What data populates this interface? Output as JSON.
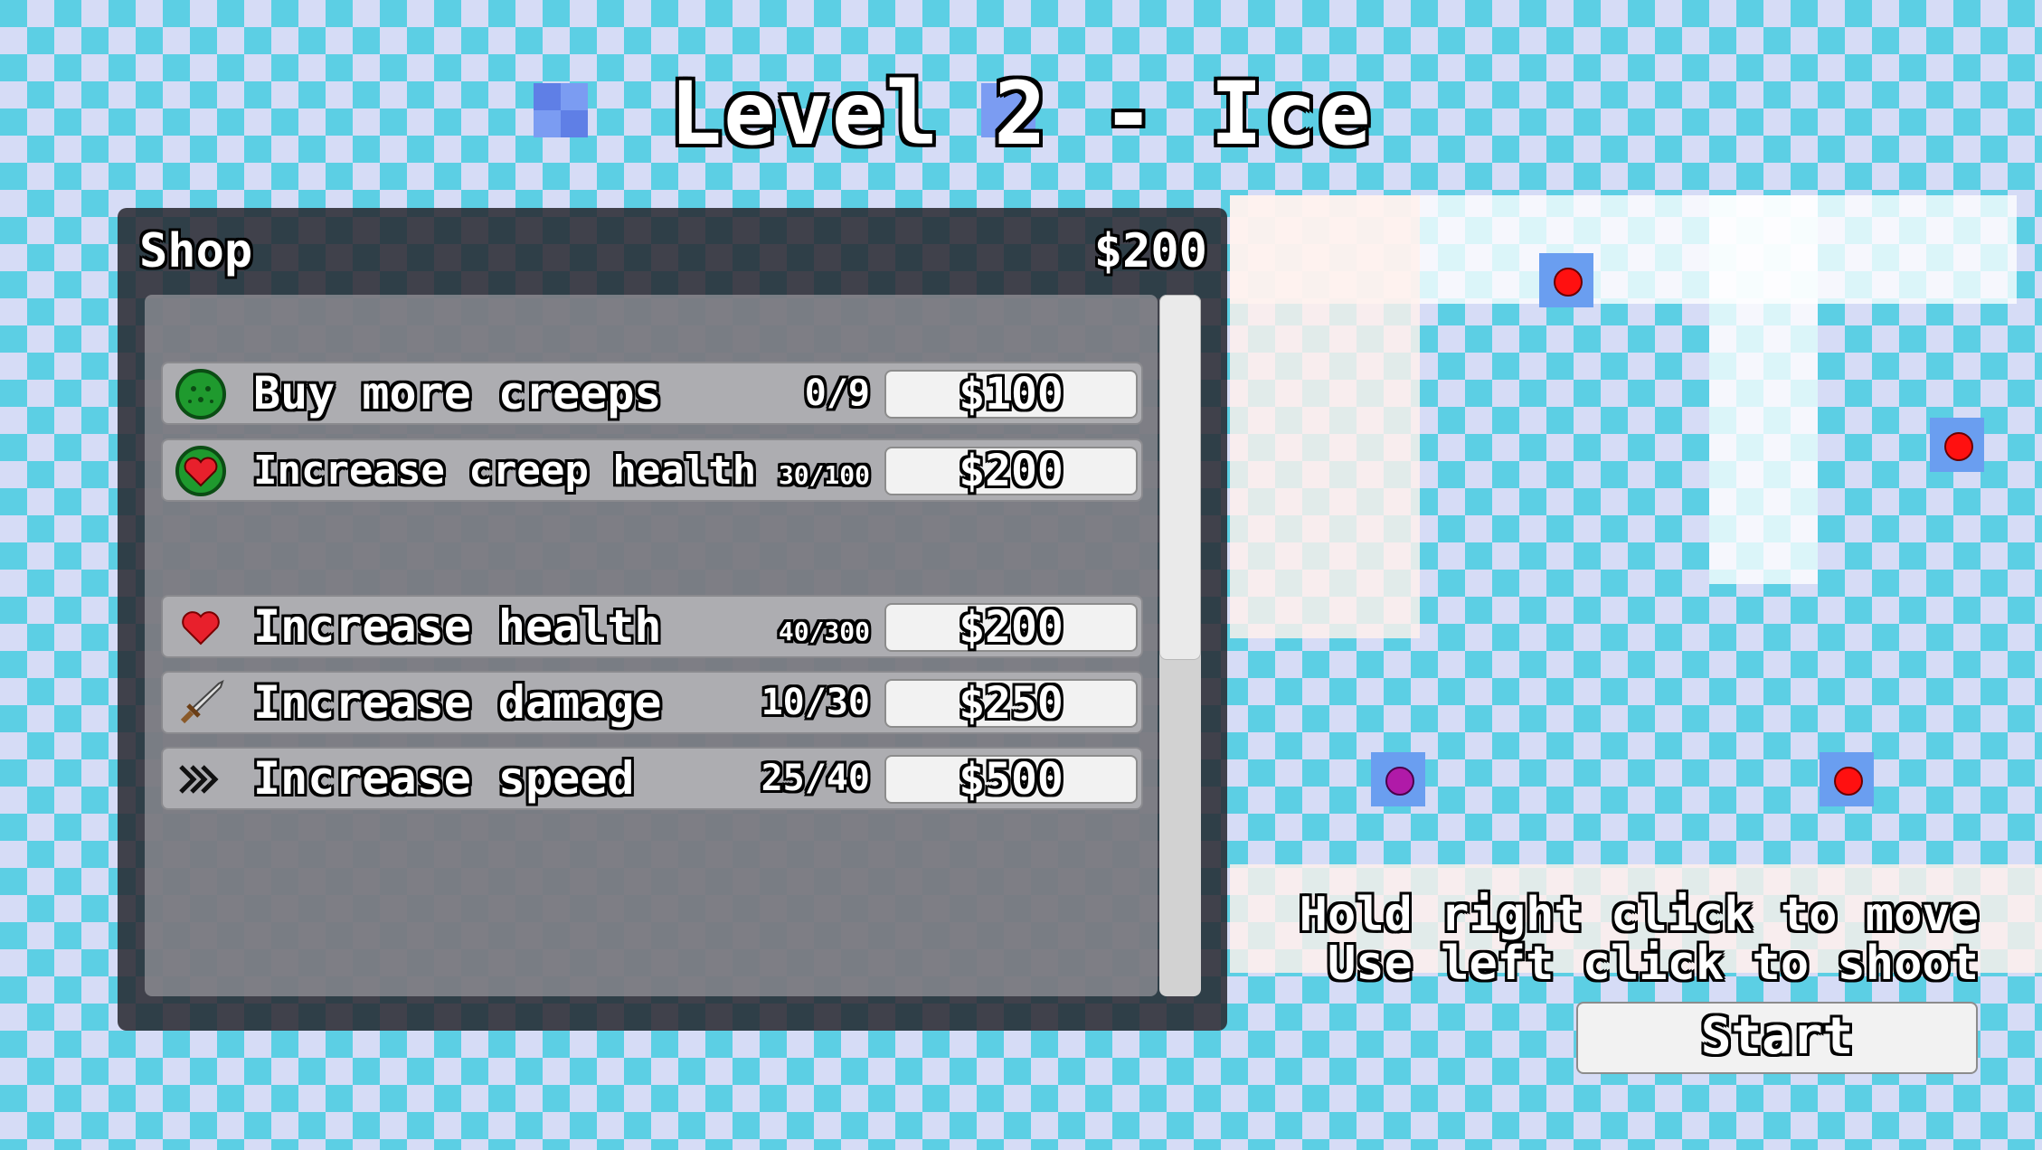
{
  "title": "Level 2 - Ice",
  "shop": {
    "title": "Shop",
    "money": "$200",
    "items": [
      {
        "label": "Buy more creeps",
        "count": "0/9",
        "price": "$100",
        "icon": "creep-icon"
      },
      {
        "label": "Increase creep health",
        "count": "30/100",
        "price": "$200",
        "icon": "creep-heart-icon"
      },
      {
        "label": "Increase health",
        "count": "40/300",
        "price": "$200",
        "icon": "heart-icon"
      },
      {
        "label": "Increase damage",
        "count": "10/30",
        "price": "$250",
        "icon": "sword-icon"
      },
      {
        "label": "Increase speed",
        "count": "25/40",
        "price": "$500",
        "icon": "chevrons-icon"
      }
    ]
  },
  "hints": {
    "move": "Hold right click to move",
    "shoot": "Use left click to shoot"
  },
  "start_label": "Start",
  "colors": {
    "ice_cyan": "#5ccfe4",
    "ice_lavender": "#d6dcf6",
    "enemy_red": "#ff1010",
    "enemy_purple": "#b01aa8",
    "creep_green": "#1f9a2e",
    "heart_red": "#e8202c"
  }
}
